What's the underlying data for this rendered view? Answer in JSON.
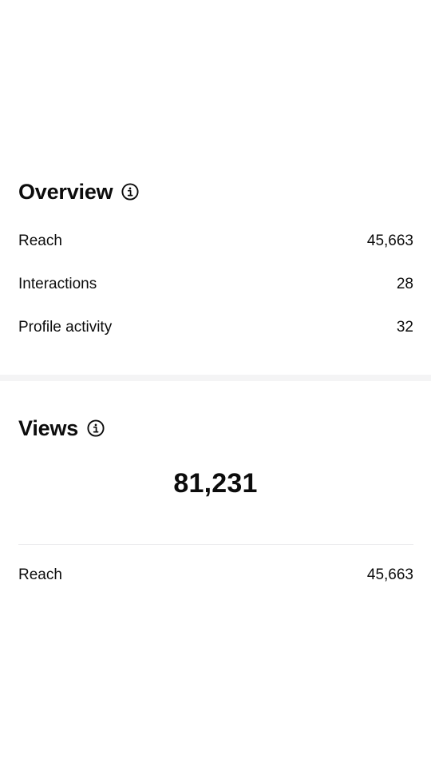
{
  "overview": {
    "title": "Overview",
    "info_icon": "info-circle-icon",
    "metrics": [
      {
        "label": "Reach",
        "value": "45,663"
      },
      {
        "label": "Interactions",
        "value": "28"
      },
      {
        "label": "Profile activity",
        "value": "32"
      }
    ]
  },
  "views": {
    "title": "Views",
    "info_icon": "info-circle-icon",
    "total": "81,231",
    "metrics": [
      {
        "label": "Reach",
        "value": "45,663"
      }
    ]
  }
}
